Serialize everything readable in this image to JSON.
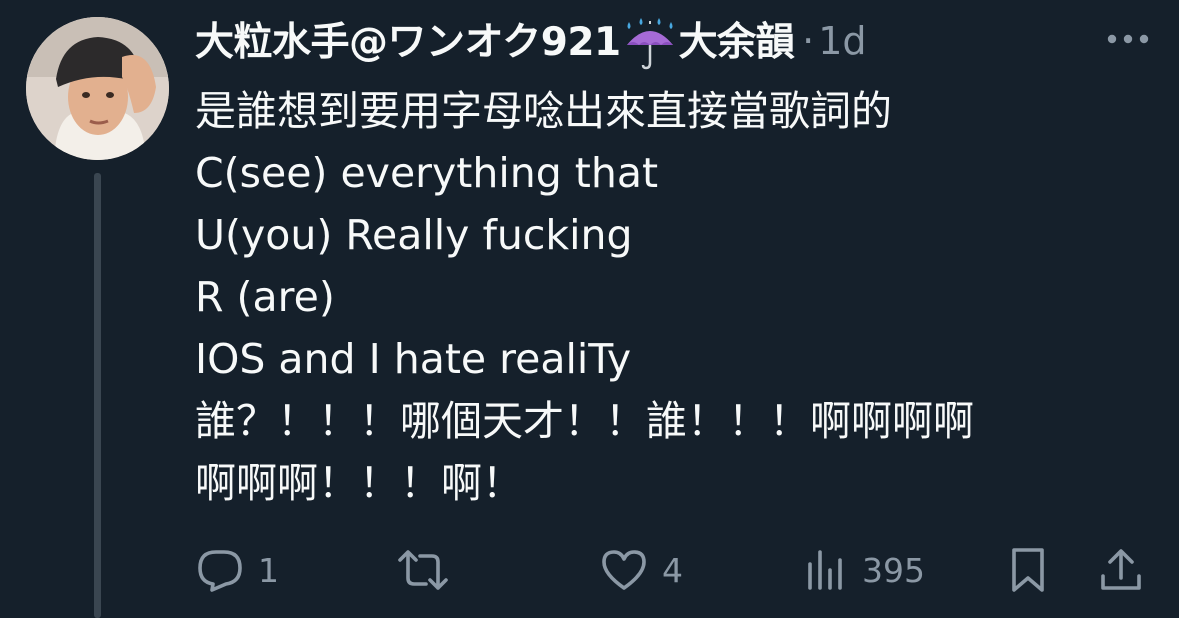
{
  "tweet": {
    "author": {
      "display_name_part1": "大粒水手@ワンオク921",
      "display_name_emoji": "umbrella-with-rain-icon",
      "display_name_part2": "大余韻"
    },
    "separator": "·",
    "timestamp": "1d",
    "text_lines": [
      "是誰想到要用字母唸出來直接當歌詞的",
      "C(see) everything that",
      "U(you) Really fucking",
      "R (are)",
      "IOS and I hate realiTy",
      "誰？！！！哪個天才！！誰！！！啊啊啊啊",
      "啊啊啊！！！啊！"
    ],
    "actions": {
      "reply": {
        "icon": "reply-icon",
        "count": "1"
      },
      "retweet": {
        "icon": "retweet-icon",
        "count": ""
      },
      "like": {
        "icon": "heart-icon",
        "count": "4"
      },
      "views": {
        "icon": "analytics-icon",
        "count": "395"
      },
      "bookmark": {
        "icon": "bookmark-icon"
      },
      "share": {
        "icon": "share-icon"
      }
    }
  },
  "colors": {
    "background": "#15202b",
    "text": "#f7f9f9",
    "muted": "#8b98a5",
    "thread_line": "#3a4651"
  }
}
